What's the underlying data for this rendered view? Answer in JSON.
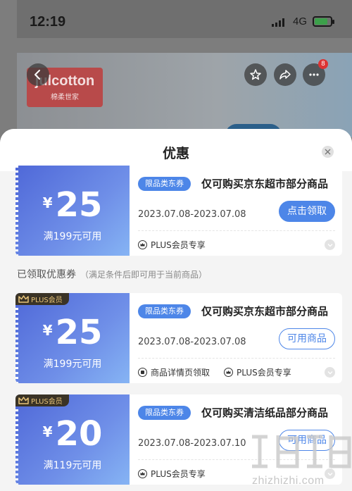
{
  "status_bar": {
    "time": "12:19",
    "network": "4G"
  },
  "background": {
    "brand_logo_text": "julcotton",
    "brand_logo_sub": "棉柔世家",
    "notification_count": "8"
  },
  "sheet": {
    "title": "优惠",
    "claimed_section_label": "已领取优惠券",
    "claimed_section_hint": "（满足条件后即可用于当前商品）"
  },
  "coupons": [
    {
      "currency": "¥",
      "amount": "25",
      "condition": "满199元可用",
      "tag": "限品类东券",
      "description": "仅可购买京东超市部分商品",
      "date_range": "2023.07.08-2023.07.08",
      "action_label": "点击领取",
      "plus_label": "PLUS会员专享"
    },
    {
      "plus_badge": "PLUS会员",
      "currency": "¥",
      "amount": "25",
      "condition": "满199元可用",
      "tag": "限品类东券",
      "description": "仅可购买京东超市部分商品",
      "date_range": "2023.07.08-2023.07.08",
      "action_label": "可用商品",
      "source_label": "商品详情页领取",
      "plus_label": "PLUS会员专享"
    },
    {
      "plus_badge": "PLUS会员",
      "currency": "¥",
      "amount": "20",
      "condition": "满119元可用",
      "tag": "限品类东券",
      "description": "仅可购买清洁纸品部分商品",
      "date_range": "2023.07.08-2023.07.10",
      "action_label": "可用商品",
      "plus_label": "PLUS会员专享"
    }
  ],
  "watermark": {
    "text": "zhizhizhi.com"
  },
  "colors": {
    "accent": "#4d86e8",
    "coupon_gradient_start": "#4f68d8",
    "coupon_gradient_end": "#86b4f4",
    "plus_gold": "#e8c47a"
  }
}
